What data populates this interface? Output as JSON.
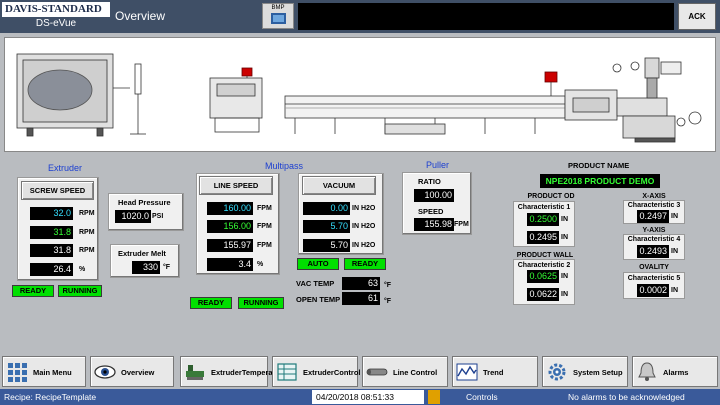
{
  "header": {
    "logo_line1": "DAVIS-STANDARD",
    "logo_line2": "DS-eVue",
    "page_title": "Overview",
    "bmp_label": "BMP",
    "ack_label": "ACK"
  },
  "extruder": {
    "title": "Extruder",
    "screw_speed_button": "SCREW SPEED",
    "values": [
      {
        "value": "32.0",
        "unit": "RPM"
      },
      {
        "value": "31.8",
        "unit": "RPM"
      },
      {
        "value": "31.8",
        "unit": "RPM"
      },
      {
        "value": "26.4",
        "unit": "%"
      }
    ],
    "status_ready": "READY",
    "status_running": "RUNNING",
    "head_pressure_label": "Head Pressure",
    "head_pressure_value": "1020.0",
    "head_pressure_unit": "PSI",
    "melt_label": "Extruder Melt",
    "melt_value": "330",
    "melt_unit": "°F"
  },
  "multipass": {
    "title": "Multipass",
    "line_speed_button": "LINE SPEED",
    "values": [
      {
        "value": "160.00",
        "unit": "FPM"
      },
      {
        "value": "156.00",
        "unit": "FPM"
      },
      {
        "value": "155.97",
        "unit": "FPM"
      },
      {
        "value": "3.4",
        "unit": "%"
      }
    ],
    "status_ready": "READY",
    "status_running": "RUNNING",
    "vacuum_button": "VACUUM",
    "vacuum_values": [
      {
        "value": "0.00",
        "unit": "IN H2O"
      },
      {
        "value": "5.70",
        "unit": "IN H2O"
      },
      {
        "value": "5.70",
        "unit": "IN H2O"
      }
    ],
    "vacuum_auto": "AUTO",
    "vacuum_ready": "READY",
    "vac_temp_label": "VAC TEMP",
    "vac_temp_value": "63",
    "vac_temp_unit": "°F",
    "open_temp_label": "OPEN TEMP",
    "open_temp_value": "61",
    "open_temp_unit": "°F"
  },
  "puller": {
    "title": "Puller",
    "ratio_label": "RATIO",
    "ratio_value": "100.00",
    "speed_label": "SPEED",
    "speed_value": "155.98",
    "speed_unit": "FPM"
  },
  "product": {
    "name_label": "PRODUCT NAME",
    "name_value": "NPE2018 PRODUCT DEMO",
    "od_label": "PRODUCT OD",
    "char1_label": "Characteristic 1",
    "char1_value": "0.2500",
    "char1_actual": "0.2495",
    "wall_label": "PRODUCT WALL",
    "char2_label": "Characteristic 2",
    "char2_value": "0.0625",
    "char2_actual": "0.0622",
    "unit": "IN",
    "xaxis_label": "X-AXIS",
    "char3_label": "Characteristic 3",
    "char3_value": "0.2497",
    "yaxis_label": "Y-AXIS",
    "char4_label": "Characteristic 4",
    "char4_value": "0.2493",
    "ovality_label": "OVALITY",
    "char5_label": "Characteristic 5",
    "char5_value": "0.0002"
  },
  "nav": {
    "main_menu": "Main Menu",
    "overview": "Overview",
    "extruder_temp_1": "Extruder",
    "extruder_temp_2": "Temperature",
    "extruder_control_1": "Extruder",
    "extruder_control_2": "Control",
    "line_control": "Line Control",
    "trend": "Trend",
    "system_setup": "System Setup",
    "alarms": "Alarms"
  },
  "statusbar": {
    "recipe": "Recipe: RecipeTemplate",
    "datetime": "04/20/2018 08:51:33",
    "controls": "Controls",
    "alarms": "No alarms to be acknowledged"
  },
  "colors": {
    "header_bg": "#3f4f66",
    "status_green": "#00e000",
    "value_cyan": "#35e0ff",
    "value_green": "#35ff35",
    "label_blue": "#1c3fd0",
    "statusbar_bg": "#3a5a9a"
  }
}
